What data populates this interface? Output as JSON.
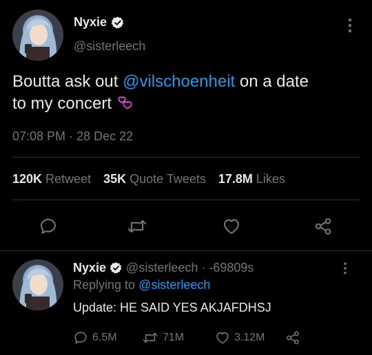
{
  "main_tweet": {
    "author_name": "Nyxie",
    "handle": "@sisterleech",
    "text_before": "Boutta ask out ",
    "mention": "@vilschoenheit",
    "text_after": " on a date",
    "text_line2": "to my concert",
    "emoji": "💞",
    "time": "07:08 PM",
    "separator": "·",
    "date": "28 Dec 22",
    "stats": {
      "retweets_count": "120K",
      "retweets_label": "Retweet",
      "quotes_count": "35K",
      "quotes_label": "Quote Tweets",
      "likes_count": "17.8M",
      "likes_label": "Likes"
    }
  },
  "reply": {
    "author_name": "Nyxie",
    "handle_time": "@sisterleech · -69809s",
    "replying_prefix": "Replying to",
    "replying_to": "@sisterleech",
    "text": "Update: HE SAID YES AKJAFDHSJ",
    "replies_count": "6.5M",
    "retweets_count": "71M",
    "likes_count": "3.12M"
  },
  "colors": {
    "background": "#000000",
    "text": "#e7e9ea",
    "muted": "#71767b",
    "accent": "#1d9bf0"
  }
}
